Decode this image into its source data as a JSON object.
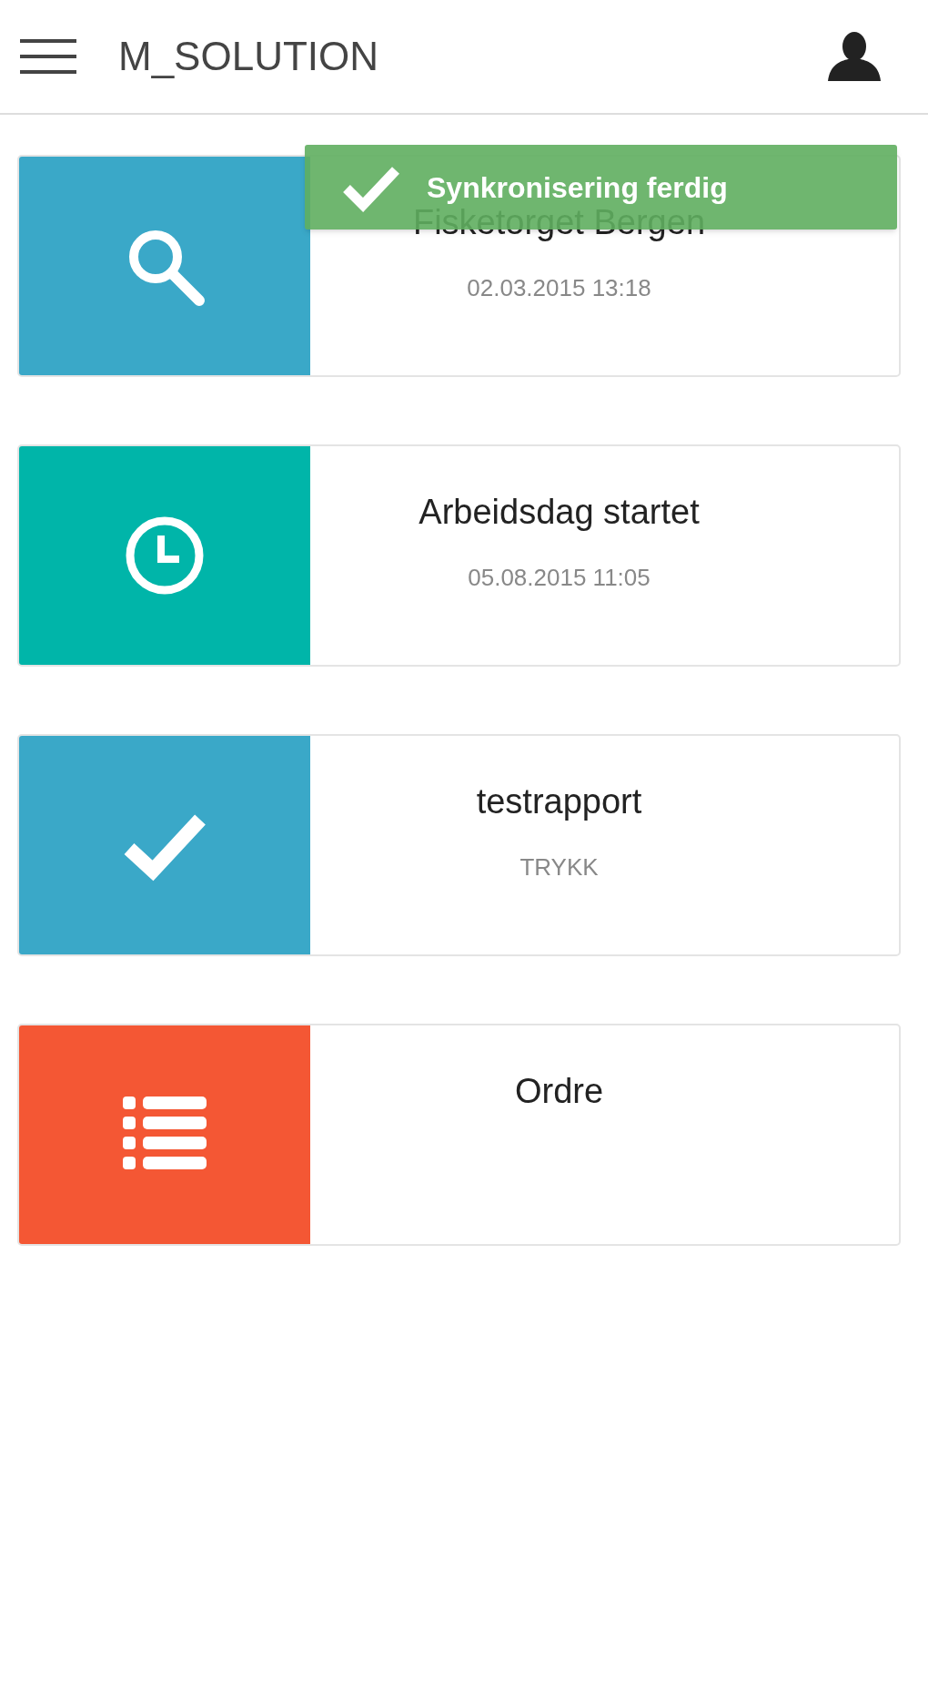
{
  "header": {
    "title": "M_SOLUTION"
  },
  "toast": {
    "message": "Synkronisering ferdig"
  },
  "cards": [
    {
      "kind": "search",
      "color": "#3aa8c8",
      "title": "Fisketorget Bergen",
      "subtitle": "02.03.2015 13:18"
    },
    {
      "kind": "clock",
      "color": "#00b5a9",
      "title": "Arbeidsdag startet",
      "subtitle": "05.08.2015 11:05"
    },
    {
      "kind": "check",
      "color": "#3aa8c8",
      "title": "testrapport",
      "subtitle": "TRYKK"
    },
    {
      "kind": "list",
      "color": "#f45734",
      "title": "Ordre"
    }
  ]
}
